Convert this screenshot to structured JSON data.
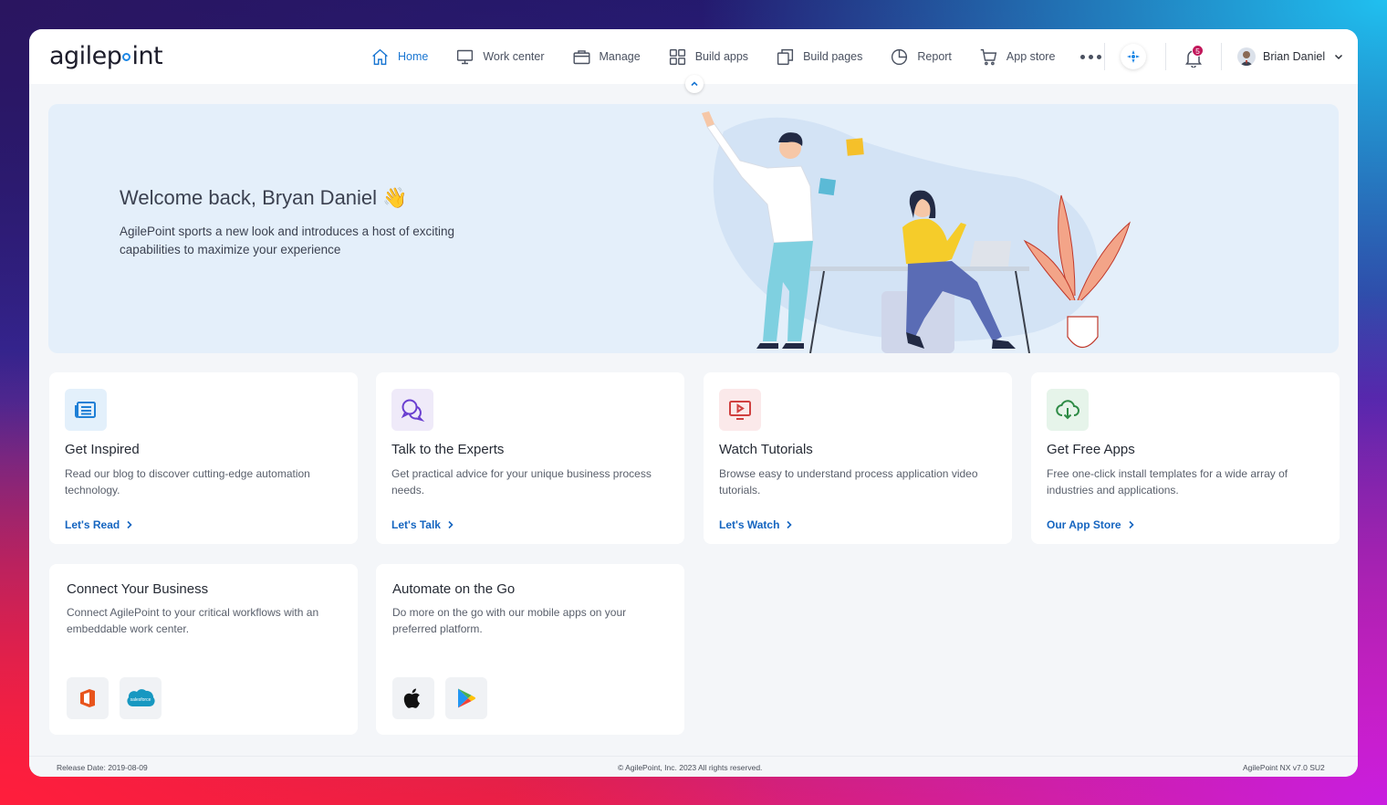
{
  "brand": {
    "logo_text_a": "agilep",
    "logo_text_b": "int"
  },
  "nav": {
    "items": [
      {
        "label": "Home",
        "icon": "home-icon"
      },
      {
        "label": "Work center",
        "icon": "monitor-icon"
      },
      {
        "label": "Manage",
        "icon": "briefcase-icon"
      },
      {
        "label": "Build apps",
        "icon": "grid-icon"
      },
      {
        "label": "Build pages",
        "icon": "pages-icon"
      },
      {
        "label": "Report",
        "icon": "pie-chart-icon"
      },
      {
        "label": "App store",
        "icon": "cart-icon"
      }
    ],
    "active_index": 0
  },
  "notifications": {
    "count": "5"
  },
  "user": {
    "name": "Brian Daniel"
  },
  "hero": {
    "title": "Welcome back, Bryan Daniel 👋",
    "text": "AgilePoint sports a new look and introduces a host of exciting capabilities to maximize your experience"
  },
  "cards": [
    {
      "title": "Get Inspired",
      "desc": "Read our blog to discover cutting-edge automation technology.",
      "link": "Let's Read",
      "icon": "newspaper-icon",
      "icon_bg": "#e3f0fb",
      "icon_color": "#1e7fd6"
    },
    {
      "title": "Talk to the Experts",
      "desc": "Get practical advice for your unique business process needs.",
      "link": "Let's Talk",
      "icon": "chat-bubbles-icon",
      "icon_bg": "#efeaf9",
      "icon_color": "#6a3fd0"
    },
    {
      "title": "Watch Tutorials",
      "desc": "Browse easy to understand process application video tutorials.",
      "link": "Let's Watch",
      "icon": "video-play-icon",
      "icon_bg": "#fbe9ea",
      "icon_color": "#d04040"
    },
    {
      "title": "Get Free Apps",
      "desc": "Free one-click install templates for a wide array of industries and applications.",
      "link": "Our App Store",
      "icon": "cloud-download-icon",
      "icon_bg": "#e6f4ea",
      "icon_color": "#2e8b46"
    }
  ],
  "bottom_cards": [
    {
      "title": "Connect Your Business",
      "desc": "Connect AgilePoint to your critical workflows with an embeddable work center.",
      "apps": [
        "office-icon",
        "salesforce-icon"
      ],
      "salesforce_text": "salesforce"
    },
    {
      "title": "Automate on the Go",
      "desc": "Do more on the go with our mobile apps on your preferred platform.",
      "apps": [
        "apple-icon",
        "google-play-icon"
      ]
    }
  ],
  "footer": {
    "release": "Release Date: 2019-08-09",
    "copyright": "© AgilePoint, Inc. 2023 All rights reserved.",
    "version": "AgilePoint NX v7.0 SU2"
  },
  "colors": {
    "accent": "#1976d2",
    "badge": "#c2185b",
    "hero_bg": "#e4effa"
  }
}
